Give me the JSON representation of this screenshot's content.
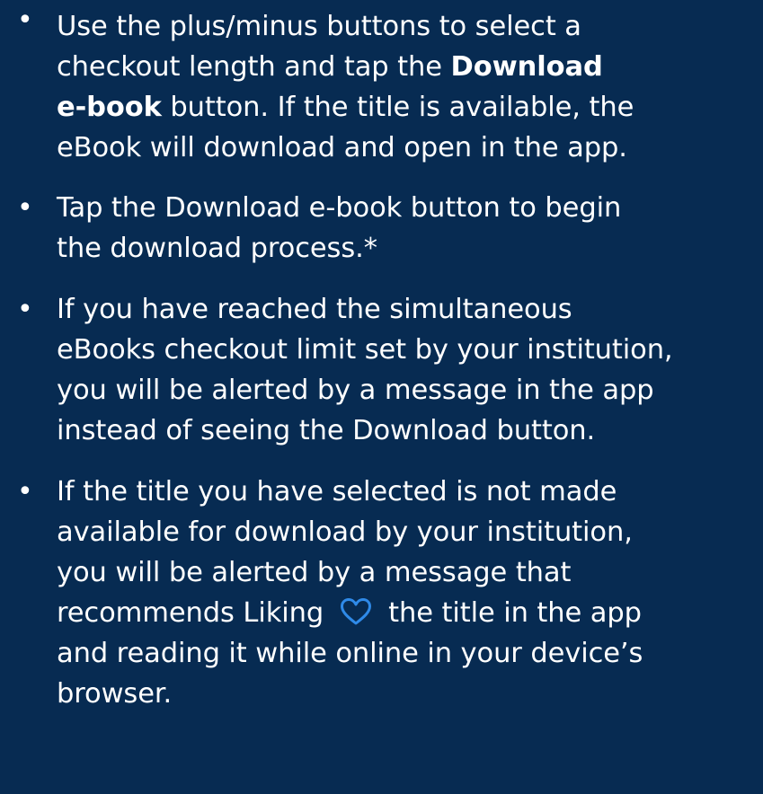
{
  "colors": {
    "background": "#072b52",
    "text": "#ffffff",
    "heart_accent": "#2f8ae8"
  },
  "bullets": {
    "marker": "•",
    "item1": {
      "line1": "Use the plus/minus buttons to select a",
      "line2_pre": "checkout length and tap the ",
      "line2_bold": "Download",
      "line3_bold": "e-book",
      "line3_post": " button. If the title is available, the",
      "line4": "eBook will download and open in the app."
    },
    "item2": {
      "line1": "Tap the Download e-book button to begin",
      "line2": "the download process.*"
    },
    "item3": {
      "line1": "If you have reached the simultaneous",
      "line2": "eBooks checkout limit set by your institution,",
      "line3": "you will be alerted by a message in the app",
      "line4": "instead of seeing the Download button."
    },
    "item4": {
      "line1": "If the title you have selected is not made",
      "line2": "available for download by your institution,",
      "line3": "you will be alerted by a message that",
      "line4_pre": "recommends Liking",
      "line4_icon": "heart-icon",
      "line4_post": "the title in the app",
      "line5": "and reading it while online in your device’s",
      "line6": "browser."
    }
  }
}
